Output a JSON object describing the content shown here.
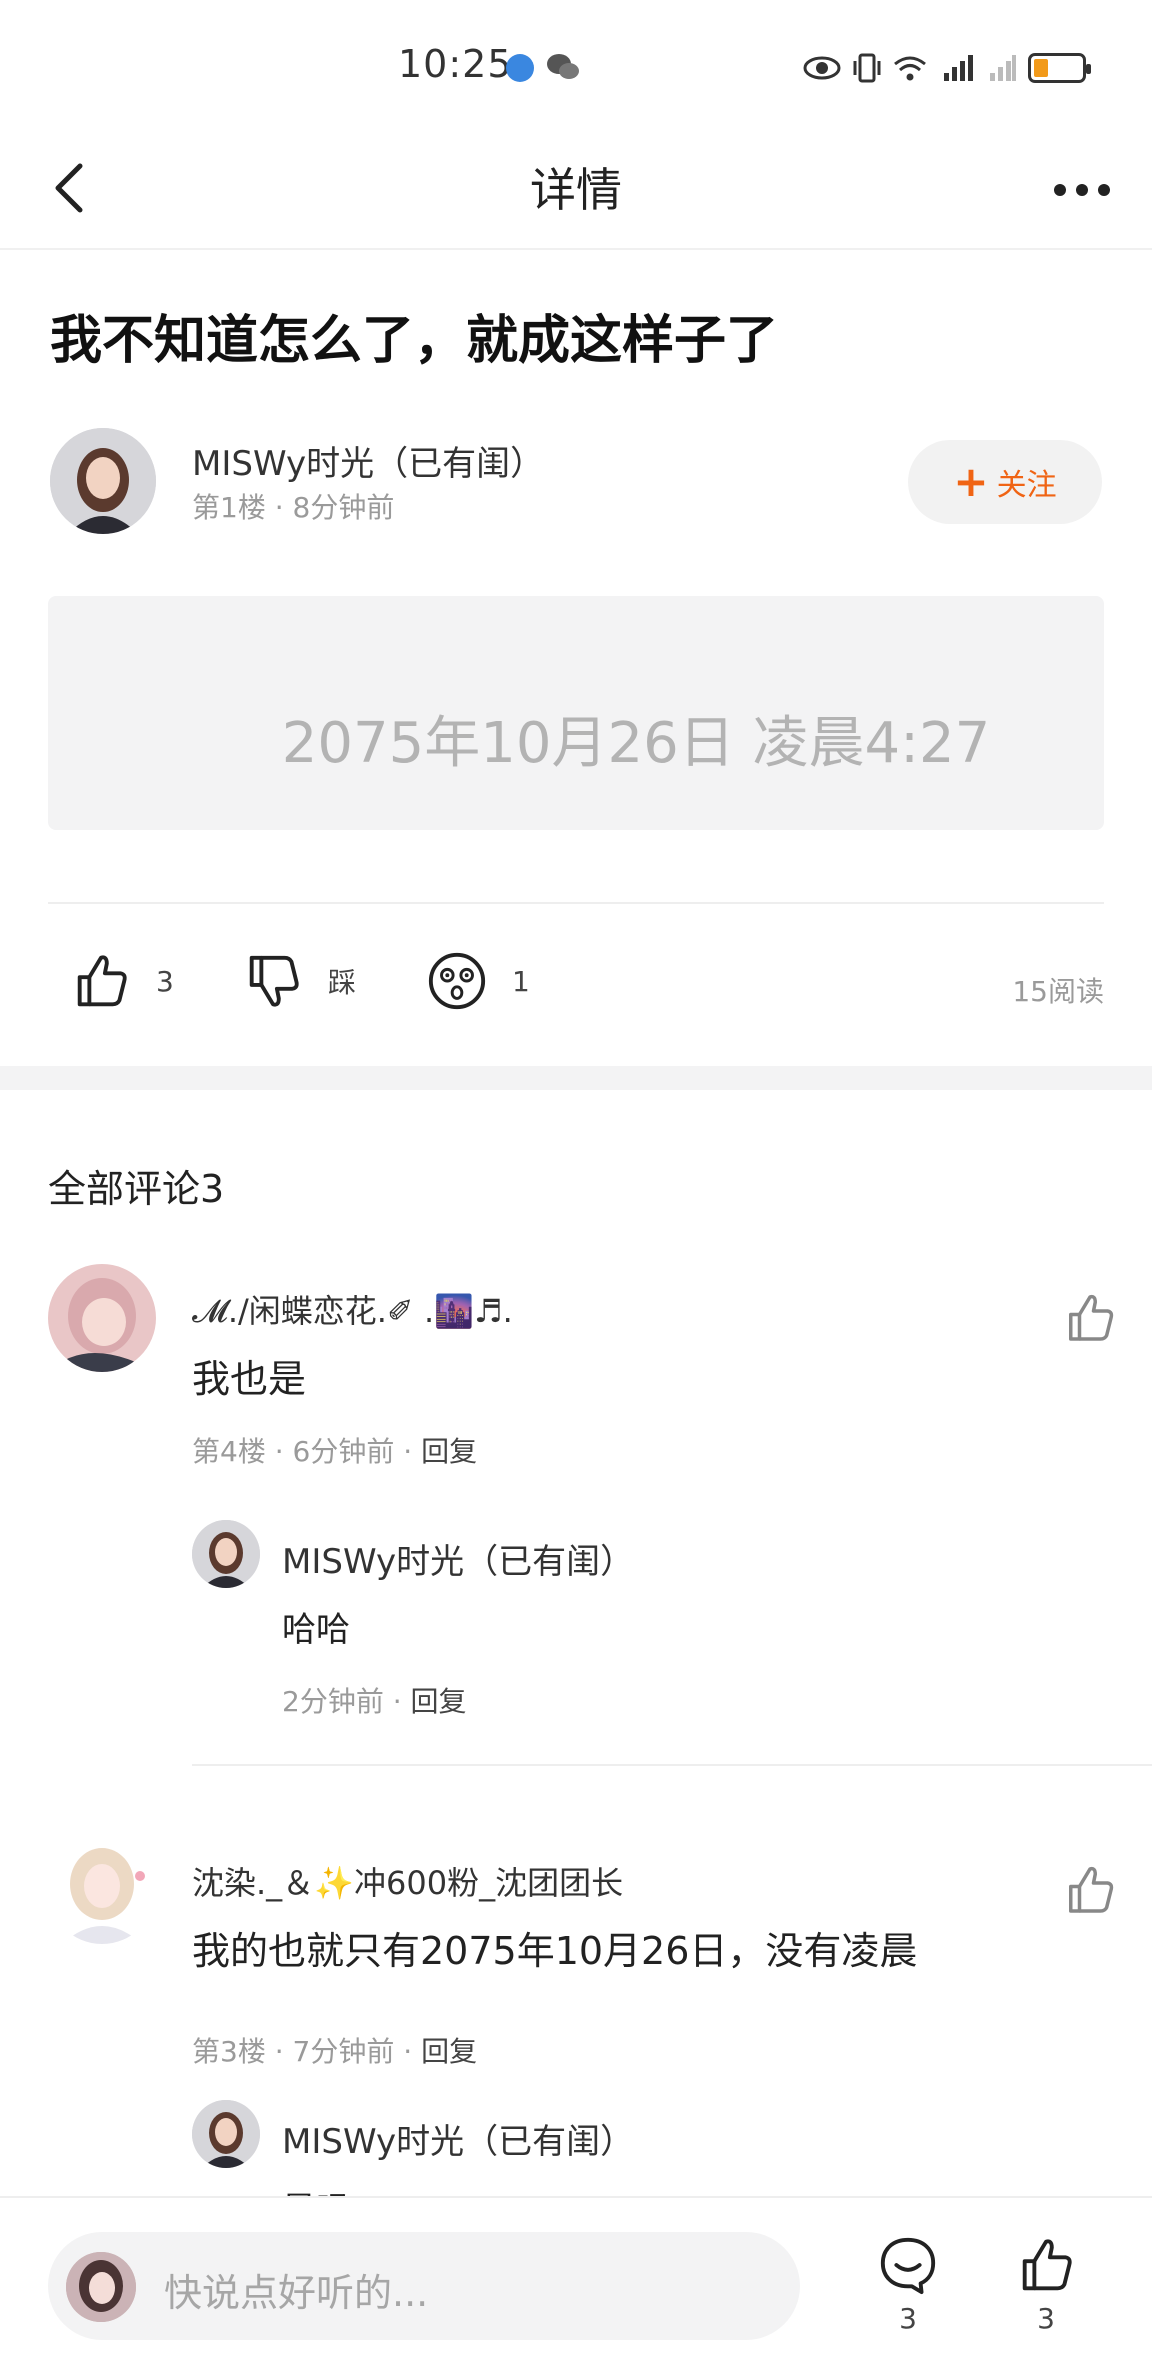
{
  "status_bar": {
    "time": "10:25"
  },
  "nav": {
    "title": "详情"
  },
  "post": {
    "title": "我不知道怎么了，就成这样子了",
    "author": {
      "name": "MISWy时光（已有闺）",
      "meta": "第1楼 · 8分钟前"
    },
    "follow_label": "关注",
    "content_text": "2075年10月26日 凌晨4:27",
    "actions": {
      "like_count": "3",
      "dislike_label": "踩",
      "emoji_count": "1",
      "read_count": "15阅读"
    }
  },
  "comments": {
    "title": "全部评论3",
    "items": [
      {
        "name": "𝓜./闲蝶恋花.✐ .🌆♬.",
        "text": "我也是",
        "floor": "第4楼",
        "time": "6分钟前",
        "reply_label": "回复",
        "reply": {
          "name": "MISWy时光（已有闺）",
          "text": "哈哈",
          "time": "2分钟前",
          "reply_label": "回复"
        }
      },
      {
        "name": "沈染._＆✨冲600粉_沈团团长",
        "text": "我的也就只有2075年10月26日，没有凌晨",
        "floor": "第3楼",
        "time": "7分钟前",
        "reply_label": "回复",
        "reply": {
          "name": "MISWy时光（已有闺）",
          "text": "是吗"
        }
      }
    ]
  },
  "bottom_bar": {
    "input_placeholder": "快说点好听的...",
    "comment_count": "3",
    "like_count": "3"
  },
  "colors": {
    "accent": "#f06414",
    "muted": "#9a9a9a",
    "content_bg": "#f3f3f4"
  }
}
